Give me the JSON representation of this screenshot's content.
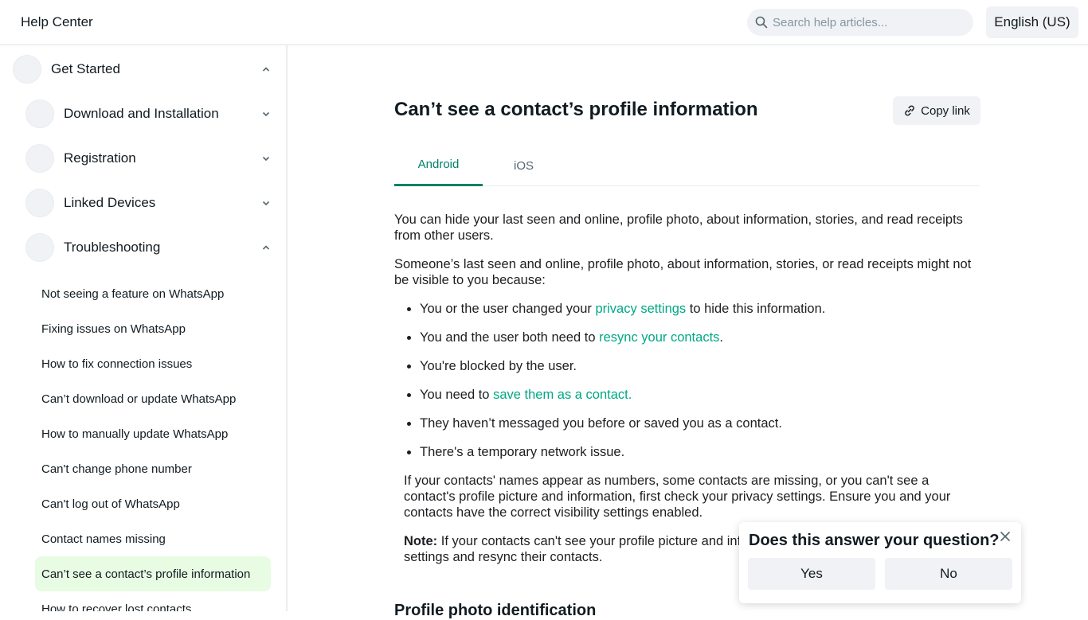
{
  "header": {
    "brand": "Help Center",
    "search_placeholder": "Search help articles...",
    "language": "English (US)"
  },
  "sidebar": {
    "sections": [
      {
        "label": "Get Started",
        "expanded": true
      },
      {
        "label": "Download and Installation",
        "expanded": false
      },
      {
        "label": "Registration",
        "expanded": false
      },
      {
        "label": "Linked Devices",
        "expanded": false
      },
      {
        "label": "Troubleshooting",
        "expanded": true
      }
    ],
    "articles": [
      "Not seeing a feature on WhatsApp",
      "Fixing issues on WhatsApp",
      "How to fix connection issues",
      "Can’t download or update WhatsApp",
      "How to manually update WhatsApp",
      "Can't change phone number",
      "Can't log out of WhatsApp",
      "Contact names missing",
      "Can’t see a contact’s profile information",
      "How to recover lost contacts"
    ],
    "active_index": 8
  },
  "article": {
    "title": "Can’t see a contact’s profile information",
    "copy_link": "Copy link",
    "tabs": [
      "Android",
      "iOS"
    ],
    "active_tab": 0,
    "p1": "You can hide your last seen and online, profile photo, about information, stories, and read receipts from other users.",
    "p2": "Someone’s last seen and online, profile photo, about information, stories, or read receipts might not be visible to you because:",
    "bullets": [
      {
        "pre": "You or the user changed your ",
        "link": "privacy settings",
        "post": " to hide this information."
      },
      {
        "pre": "You and the user both need to ",
        "link": "resync your contacts",
        "post": "."
      },
      {
        "pre": "You're blocked by the user.",
        "link": "",
        "post": ""
      },
      {
        "pre": "You need to ",
        "link": "save them as a contact.",
        "post": ""
      },
      {
        "pre": "They haven’t messaged you before or saved you as a contact.",
        "link": "",
        "post": ""
      },
      {
        "pre": "There's a temporary network issue.",
        "link": "",
        "post": ""
      }
    ],
    "p3": "If your contacts' names appear as numbers, some contacts are missing, or you can't see a contact's profile picture and information, first check your privacy settings. Ensure you and your contacts have the correct visibility settings enabled.",
    "note_label": "Note:",
    "note_text": " If your contacts can't see your profile picture and information, they should check their privacy settings and resync their contacts.",
    "next_heading": "Profile photo identification"
  },
  "feedback": {
    "question": "Does this answer your question?",
    "yes": "Yes",
    "no": "No"
  },
  "colors": {
    "accent_green": "#008069",
    "link_teal": "#00a884",
    "active_item_bg": "#e7fce3",
    "button_bg": "#f0f2f5"
  },
  "icons": [
    "search-icon",
    "chevron-up-icon",
    "chevron-down-icon",
    "link-icon",
    "close-icon"
  ]
}
